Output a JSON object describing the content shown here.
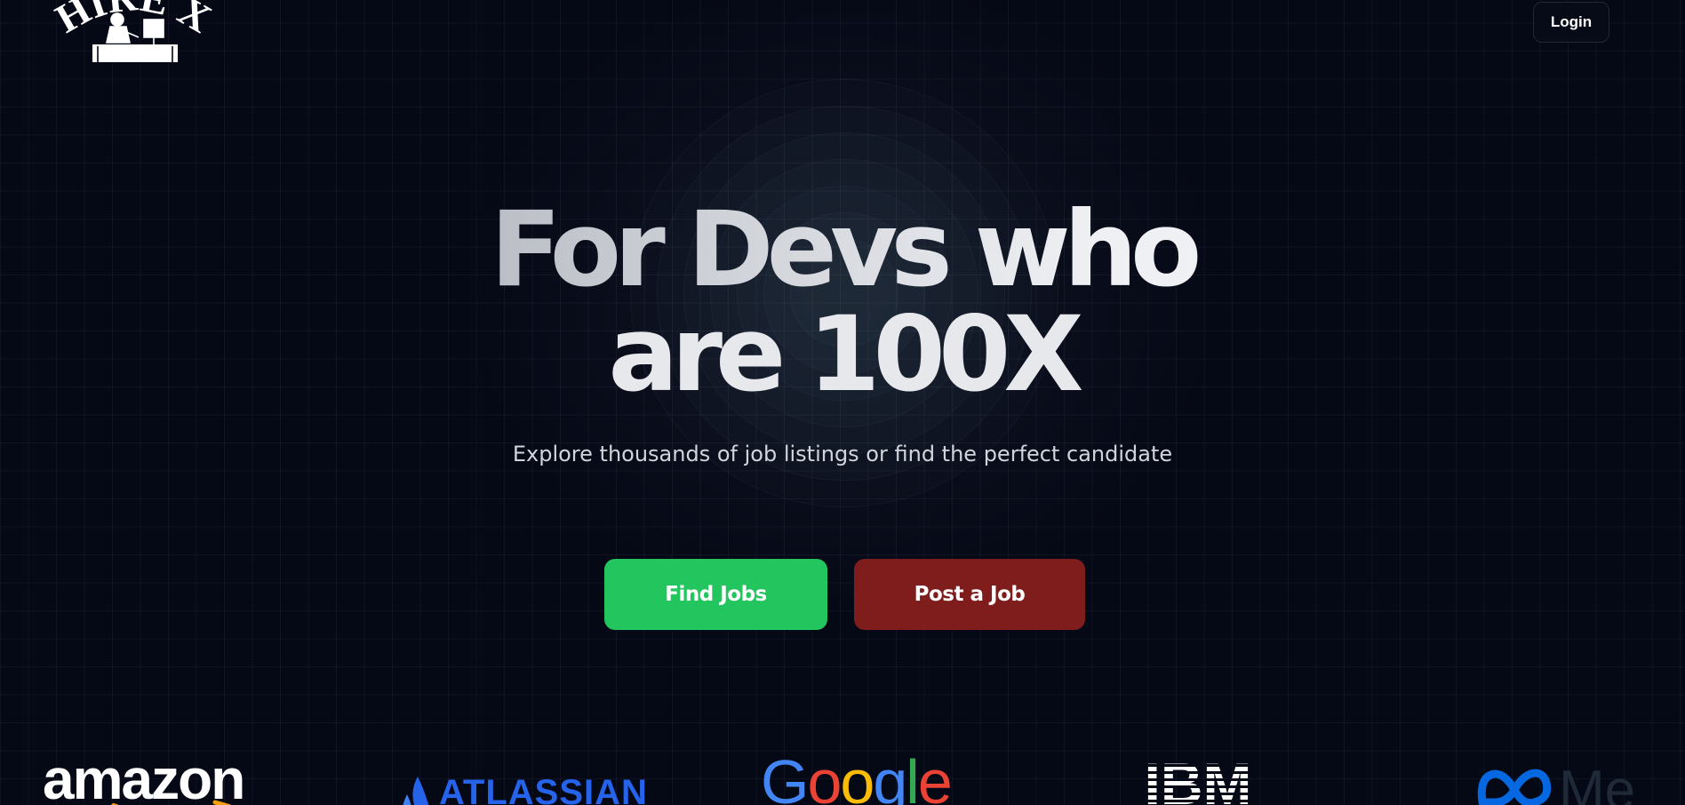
{
  "header": {
    "logo_text": "HIRE X",
    "login_label": "Login"
  },
  "hero": {
    "title_line1": "For Devs who",
    "title_line2": "are 100X",
    "subtitle": "Explore thousands of job listings or find the perfect candidate"
  },
  "actions": {
    "find_jobs_label": "Find Jobs",
    "post_job_label": "Post a Job"
  },
  "brands": {
    "amazon": "amazon",
    "atlassian": "ATLASSIAN",
    "google": [
      "G",
      "o",
      "o",
      "g",
      "l",
      "e"
    ],
    "ibm": "IBM",
    "meta": "Me"
  },
  "colors": {
    "background": "#050815",
    "find_jobs": "#22c55e",
    "post_job": "#7f1d1d",
    "atlassian_blue": "#2563eb",
    "meta_blue": "#0668e1"
  }
}
